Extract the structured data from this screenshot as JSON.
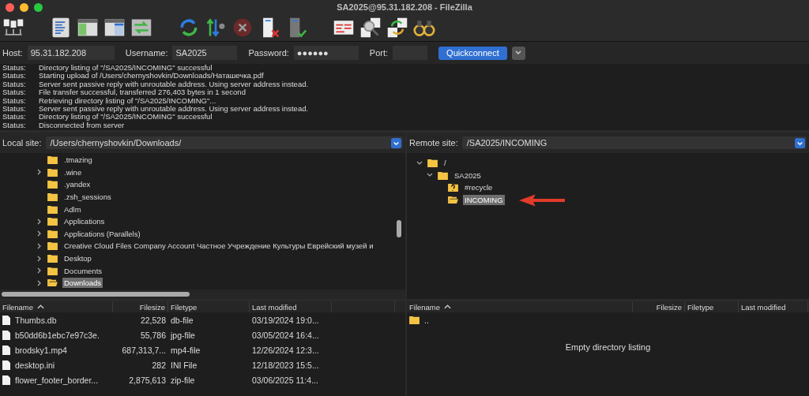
{
  "window": {
    "title": "SA2025@95.31.182.208 - FileZilla"
  },
  "quickconnect": {
    "host_label": "Host:",
    "host": "95.31.182.208",
    "username_label": "Username:",
    "username": "SA2025",
    "password_label": "Password:",
    "password": "●●●●●●",
    "port_label": "Port:",
    "button": "Quickconnect"
  },
  "log": [
    {
      "type": "Status:",
      "message": "Directory listing of \"/SA2025/INCOMING\" successful"
    },
    {
      "type": "Status:",
      "message": "Starting upload of /Users/chernyshovkin/Downloads/Наташечка.pdf"
    },
    {
      "type": "Status:",
      "message": "Server sent passive reply with unroutable address. Using server address instead."
    },
    {
      "type": "Status:",
      "message": "File transfer successful, transferred 276,403 bytes in 1 second"
    },
    {
      "type": "Status:",
      "message": "Retrieving directory listing of \"/SA2025/INCOMING\"..."
    },
    {
      "type": "Status:",
      "message": "Server sent passive reply with unroutable address. Using server address instead."
    },
    {
      "type": "Status:",
      "message": "Directory listing of \"/SA2025/INCOMING\" successful"
    },
    {
      "type": "Status:",
      "message": "Disconnected from server"
    }
  ],
  "local": {
    "site_label": "Local site:",
    "path": "/Users/chernyshovkin/Downloads/",
    "tree": [
      {
        "name": ".tmazing",
        "selected": false,
        "kind": "folder"
      },
      {
        "name": ".wine",
        "expanded": false,
        "selected": false,
        "kind": "folder"
      },
      {
        "name": ".yandex",
        "selected": false,
        "kind": "folder"
      },
      {
        "name": ".zsh_sessions",
        "selected": false,
        "kind": "folder"
      },
      {
        "name": "Adlm",
        "selected": false,
        "kind": "folder"
      },
      {
        "name": "Applications",
        "expanded": false,
        "selected": false,
        "kind": "folder"
      },
      {
        "name": "Applications (Parallels)",
        "expanded": false,
        "selected": false,
        "kind": "folder"
      },
      {
        "name": "Creative Cloud Files Company Account Частное Учреждение Культуры Еврейский музей и",
        "expanded": false,
        "selected": false,
        "kind": "folder"
      },
      {
        "name": "Desktop",
        "expanded": false,
        "selected": false,
        "kind": "folder"
      },
      {
        "name": "Documents",
        "expanded": false,
        "selected": false,
        "kind": "folder"
      },
      {
        "name": "Downloads",
        "expanded": false,
        "selected": true,
        "kind": "folder"
      }
    ],
    "columns": [
      "Filename",
      "Filesize",
      "Filetype",
      "Last modified"
    ],
    "files": [
      {
        "name": "Thumbs.db",
        "size": "22,528",
        "type": "db-file",
        "modified": "03/19/2024 19:0..."
      },
      {
        "name": "b50dd6b1ebc7e97c3e.",
        "size": "55,786",
        "type": "jpg-file",
        "modified": "03/05/2024 16:4..."
      },
      {
        "name": "brodsky1.mp4",
        "size": "687,313,7...",
        "type": "mp4-file",
        "modified": "12/26/2024 12:3..."
      },
      {
        "name": "desktop.ini",
        "size": "282",
        "type": "INI File",
        "modified": "12/18/2023 15:5..."
      },
      {
        "name": "flower_footer_border...",
        "size": "2,875,613",
        "type": "zip-file",
        "modified": "03/06/2025 11:4..."
      }
    ]
  },
  "remote": {
    "site_label": "Remote site:",
    "path": "/SA2025/INCOMING",
    "tree": [
      {
        "name": "/",
        "expanded": true,
        "selected": false,
        "kind": "folder",
        "children": [
          {
            "name": "SA2025",
            "expanded": true,
            "selected": false,
            "kind": "folder",
            "children": [
              {
                "name": "#recycle",
                "selected": false,
                "kind": "unknown"
              },
              {
                "name": "INCOMING",
                "selected": true,
                "kind": "folder"
              }
            ]
          }
        ]
      }
    ],
    "columns": [
      "Filename",
      "Filesize",
      "Filetype",
      "Last modified"
    ],
    "files": [
      {
        "name": "..",
        "kind": "parent"
      }
    ],
    "empty_message": "Empty directory listing"
  }
}
